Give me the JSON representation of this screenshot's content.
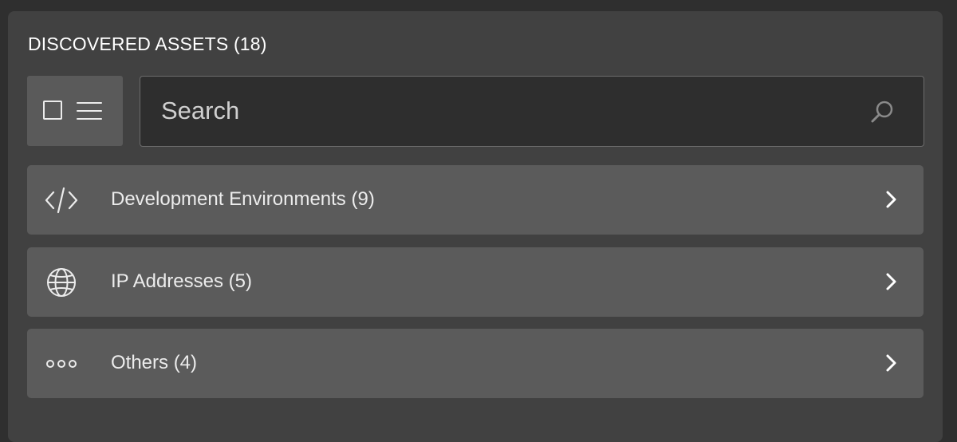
{
  "panel": {
    "title": "DISCOVERED ASSETS (18)"
  },
  "toolbar": {
    "view_toggle_icons": [
      "checkbox-icon",
      "list-menu-icon"
    ]
  },
  "search": {
    "placeholder": "Search",
    "value": "",
    "icon": "search-icon"
  },
  "categories": [
    {
      "label": "Development Environments (9)",
      "icon": "code-icon"
    },
    {
      "label": "IP Addresses (5)",
      "icon": "globe-icon"
    },
    {
      "label": "Others (4)",
      "icon": "more-dots-icon"
    }
  ],
  "colors": {
    "background": "#2f2f2f",
    "panel": "#414141",
    "row": "#5b5b5b",
    "search_bg": "#2e2e2e",
    "text": "#ececec"
  }
}
